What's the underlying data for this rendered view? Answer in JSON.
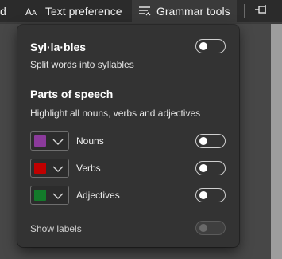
{
  "toolbar": {
    "partial_label": "d",
    "text_preference": "Text preference",
    "grammar_tools": "Grammar tools"
  },
  "flyout": {
    "syllables": {
      "title": "Syl·la·bles",
      "description": "Split words into syllables",
      "toggle_on": false
    },
    "parts_of_speech": {
      "title": "Parts of speech",
      "description": "Highlight all nouns, verbs and adjectives",
      "items": [
        {
          "label": "Nouns",
          "color": "#8b3a9b",
          "toggle_on": false
        },
        {
          "label": "Verbs",
          "color": "#c00000",
          "toggle_on": false
        },
        {
          "label": "Adjectives",
          "color": "#137a2a",
          "toggle_on": false
        }
      ]
    },
    "show_labels": {
      "label": "Show labels",
      "toggle_on": false,
      "disabled": true
    }
  },
  "icons": {
    "text_preference": "text-size-icon",
    "grammar_tools": "grammar-lines-icon",
    "pin": "pin-icon",
    "chevron": "chevron-down-icon"
  }
}
